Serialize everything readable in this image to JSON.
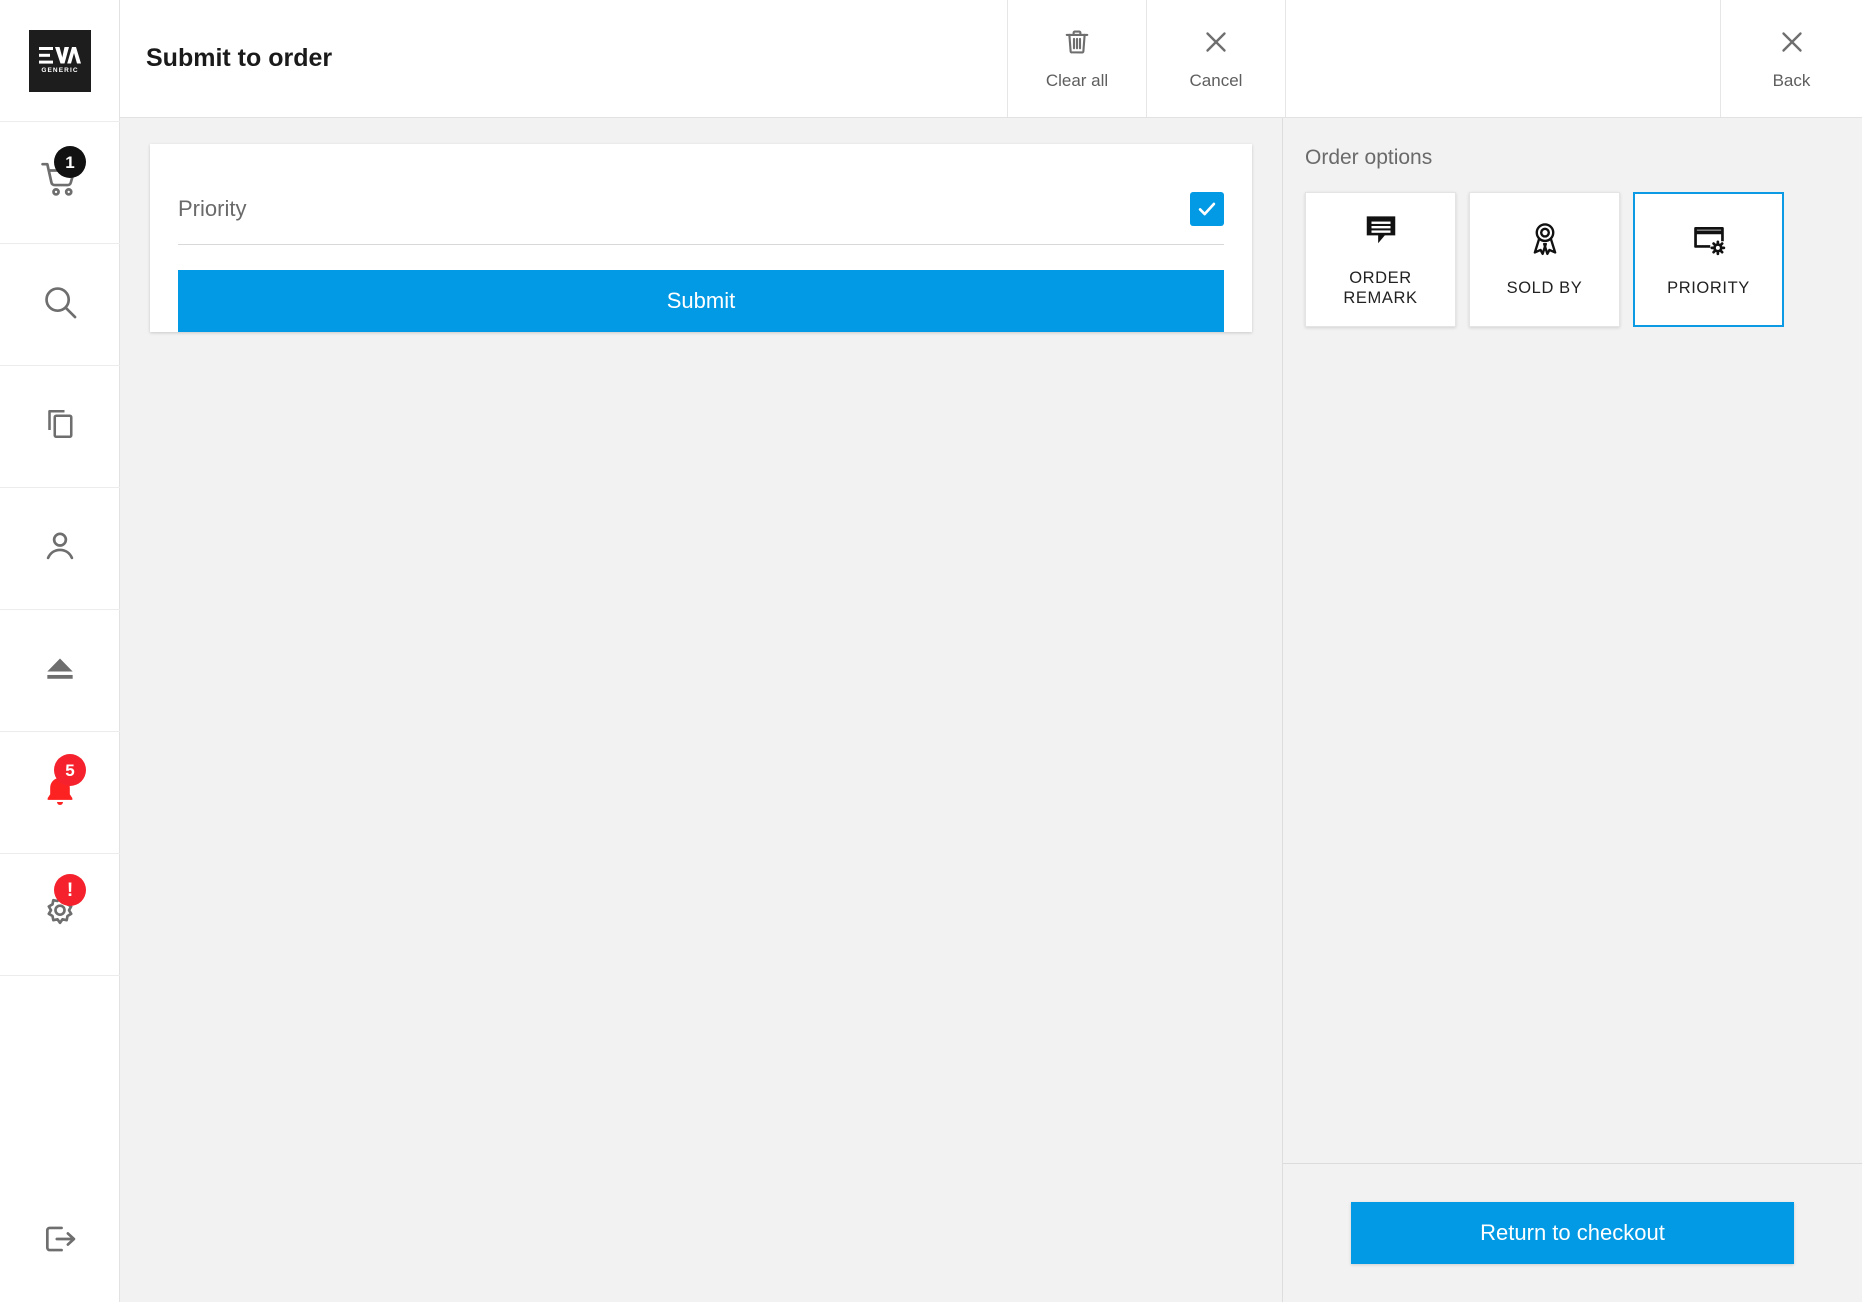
{
  "sidebar": {
    "logo": {
      "mark": "EVA",
      "sub": "GENERIC"
    },
    "items": [
      {
        "name": "cart",
        "icon": "shopping-cart-icon",
        "badge": "1",
        "badge_color": "#111111"
      },
      {
        "name": "search",
        "icon": "search-icon",
        "badge": null
      },
      {
        "name": "documents",
        "icon": "copy-documents-icon",
        "badge": null
      },
      {
        "name": "user",
        "icon": "person-icon",
        "badge": null
      },
      {
        "name": "eject",
        "icon": "eject-icon",
        "badge": null
      },
      {
        "name": "notifications",
        "icon": "bell-icon",
        "badge": "5",
        "badge_color": "#f5222d"
      },
      {
        "name": "settings",
        "icon": "gear-icon",
        "badge": "!",
        "badge_color": "#f5222d"
      }
    ],
    "logout": {
      "name": "logout",
      "icon": "logout-icon"
    }
  },
  "topbar": {
    "title": "Submit to order",
    "clear_all_label": "Clear all",
    "cancel_label": "Cancel",
    "back_label": "Back"
  },
  "form": {
    "priority_label": "Priority",
    "priority_checked": true,
    "submit_label": "Submit"
  },
  "order_options": {
    "heading": "Order options",
    "cards": [
      {
        "label": "ORDER REMARK",
        "icon": "comment-lines-icon",
        "selected": false
      },
      {
        "label": "SOLD BY",
        "icon": "award-ribbon-icon",
        "selected": false
      },
      {
        "label": "PRIORITY",
        "icon": "card-settings-icon",
        "selected": true
      }
    ],
    "return_label": "Return to checkout"
  },
  "colors": {
    "accent": "#029ae4",
    "selected_border": "#0d9ae5",
    "badge_red": "#f5222d",
    "badge_dark": "#111111",
    "panel_bg": "#f2f2f2"
  }
}
